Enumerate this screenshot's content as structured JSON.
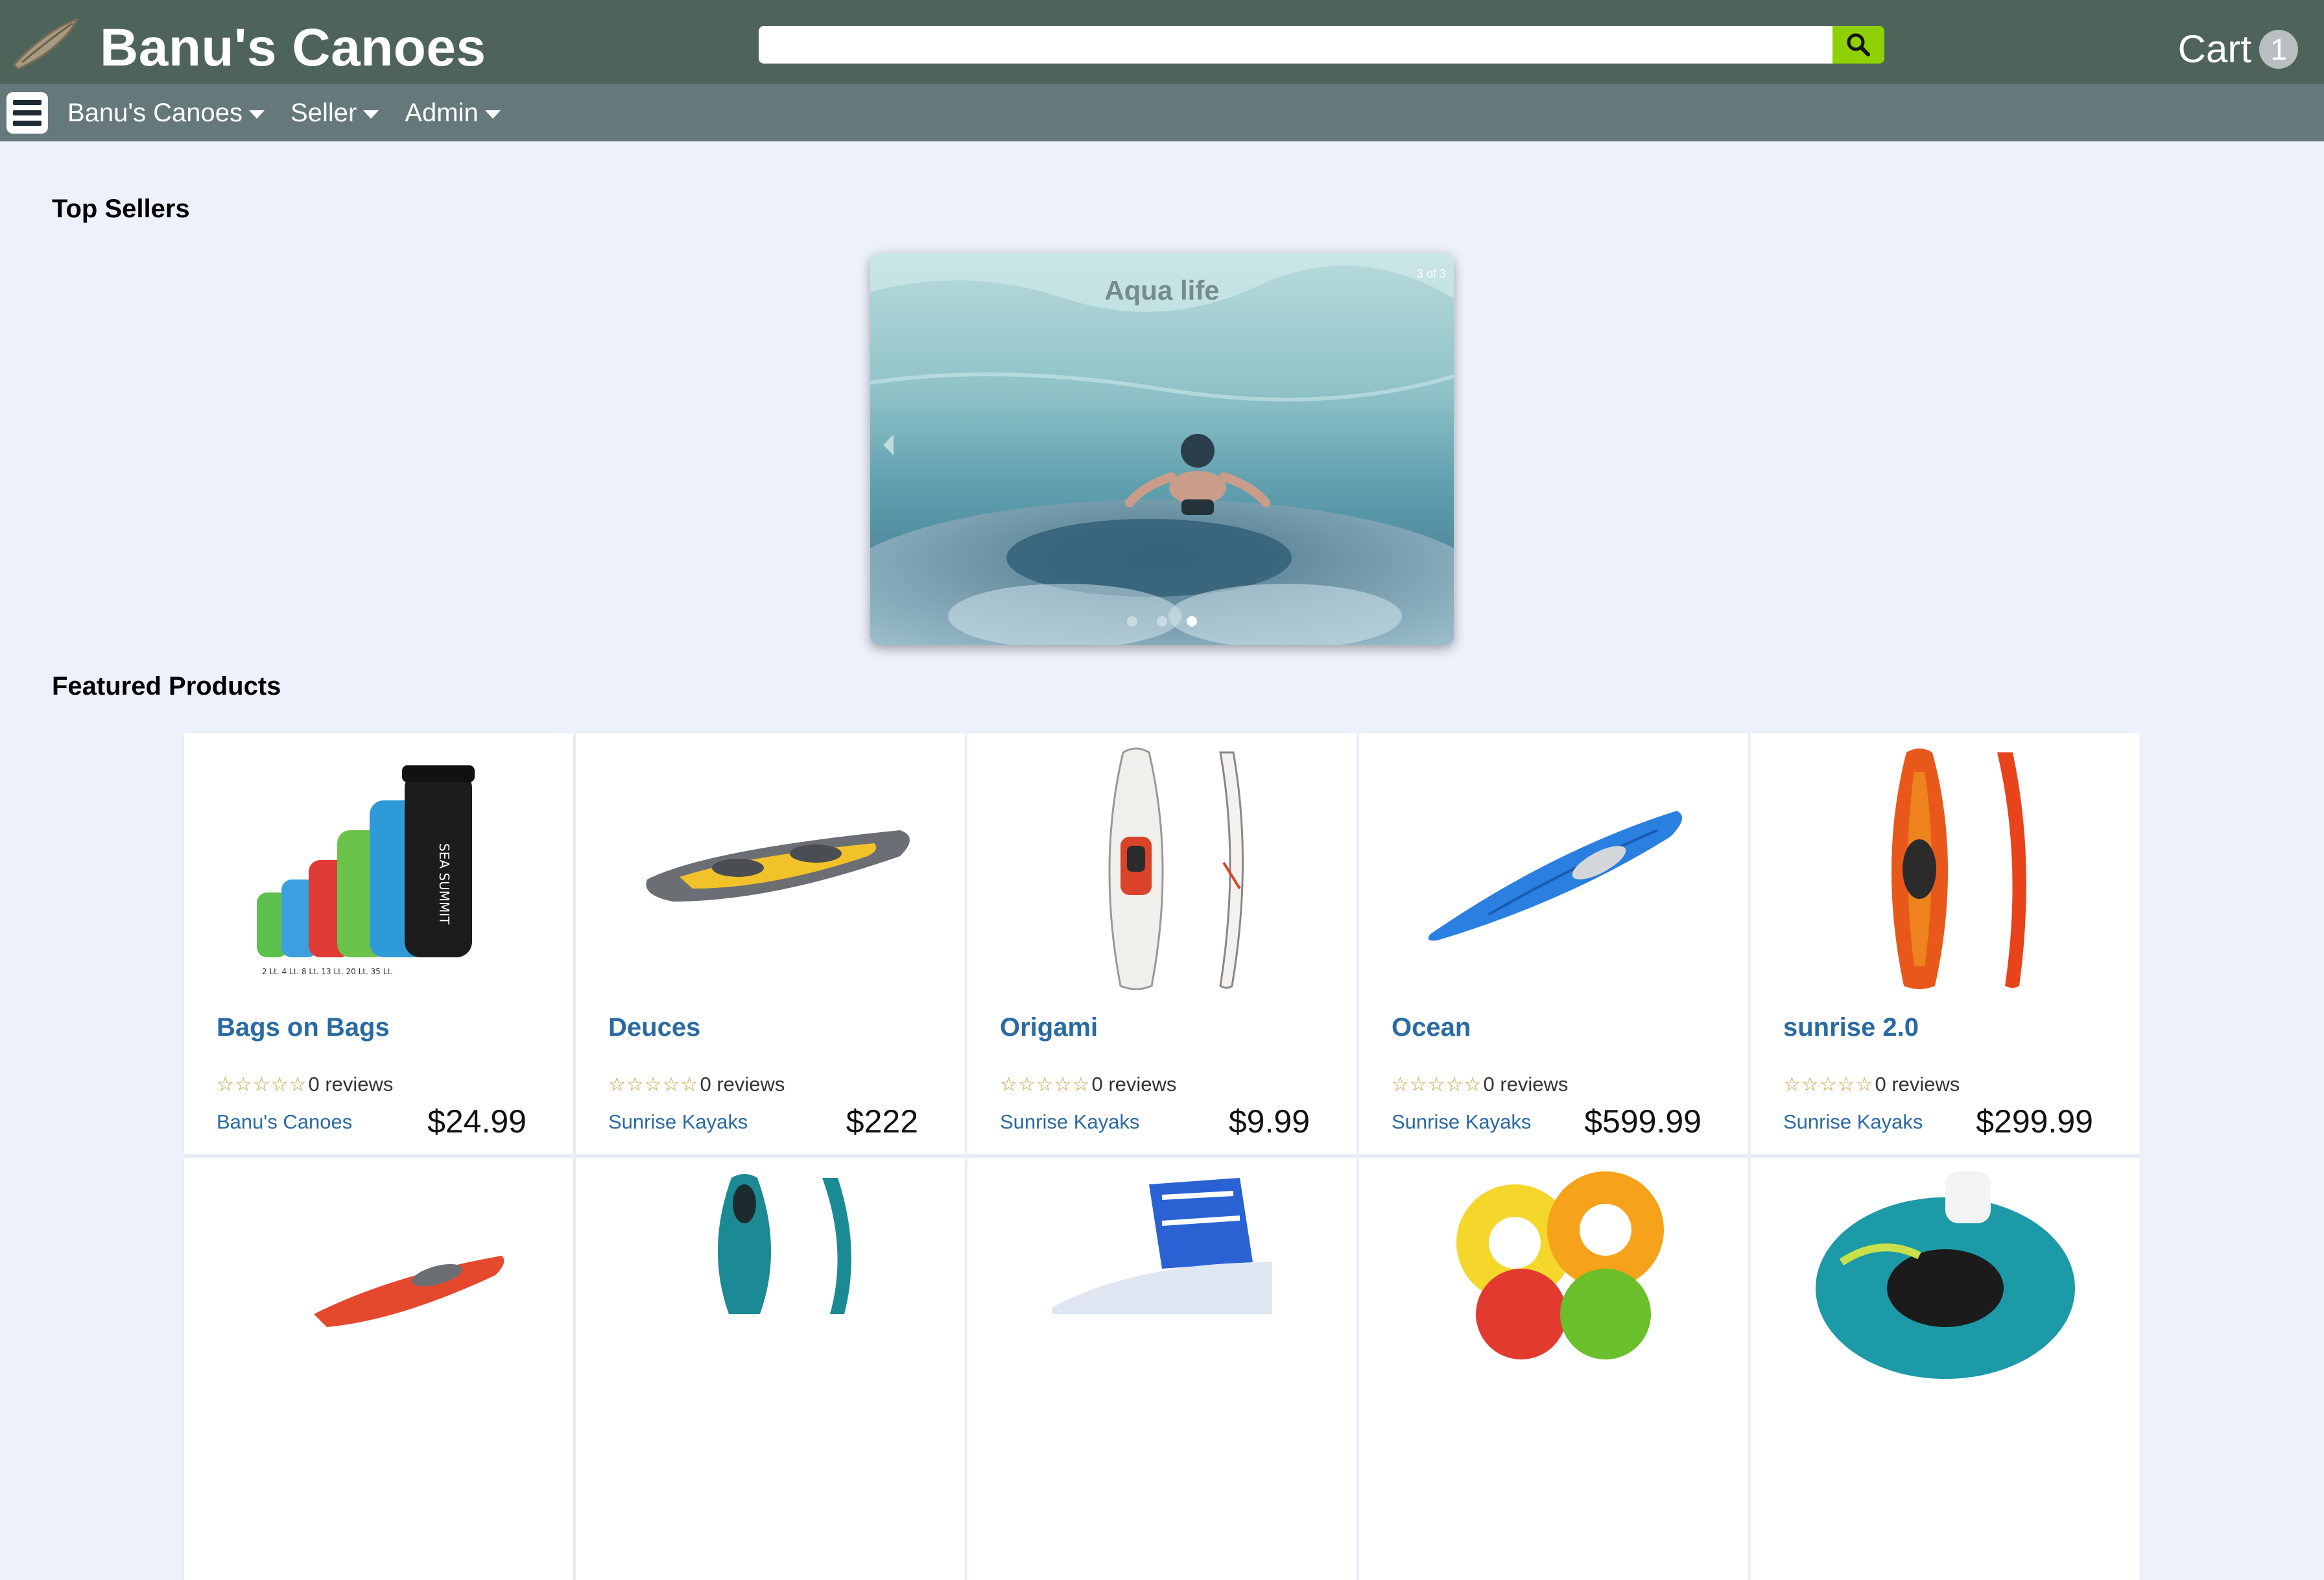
{
  "header": {
    "title": "Banu's Canoes",
    "search_placeholder": "",
    "cart_label": "Cart",
    "cart_count": "1"
  },
  "nav": {
    "items": [
      {
        "label": "Banu's Canoes"
      },
      {
        "label": "Seller"
      },
      {
        "label": "Admin"
      }
    ]
  },
  "top_sellers": {
    "heading": "Top Sellers",
    "slide_caption": "Aqua life",
    "slide_counter": "3 of 3",
    "slide_count": 3,
    "active_slide": 3
  },
  "featured": {
    "heading": "Featured Products",
    "products": [
      {
        "name": "Bags on Bags",
        "reviews": "0 reviews",
        "seller": "Banu's Canoes",
        "price": "$24.99",
        "image": "dry-bags"
      },
      {
        "name": "Deuces",
        "reviews": "0 reviews",
        "seller": "Sunrise Kayaks",
        "price": "$222",
        "image": "inflatable-kayak"
      },
      {
        "name": "Origami",
        "reviews": "0 reviews",
        "seller": "Sunrise Kayaks",
        "price": "$9.99",
        "image": "folding-kayak"
      },
      {
        "name": "Ocean",
        "reviews": "0 reviews",
        "seller": "Sunrise Kayaks",
        "price": "$599.99",
        "image": "blue-kayak"
      },
      {
        "name": "sunrise 2.0",
        "reviews": "0 reviews",
        "seller": "Sunrise Kayaks",
        "price": "$299.99",
        "image": "orange-kayak"
      }
    ]
  },
  "colors": {
    "topbar": "#4e645a",
    "navbar": "#65797c",
    "search_button": "#8fd000",
    "link": "#2a6aa4",
    "page_bg": "#edf1fc"
  }
}
